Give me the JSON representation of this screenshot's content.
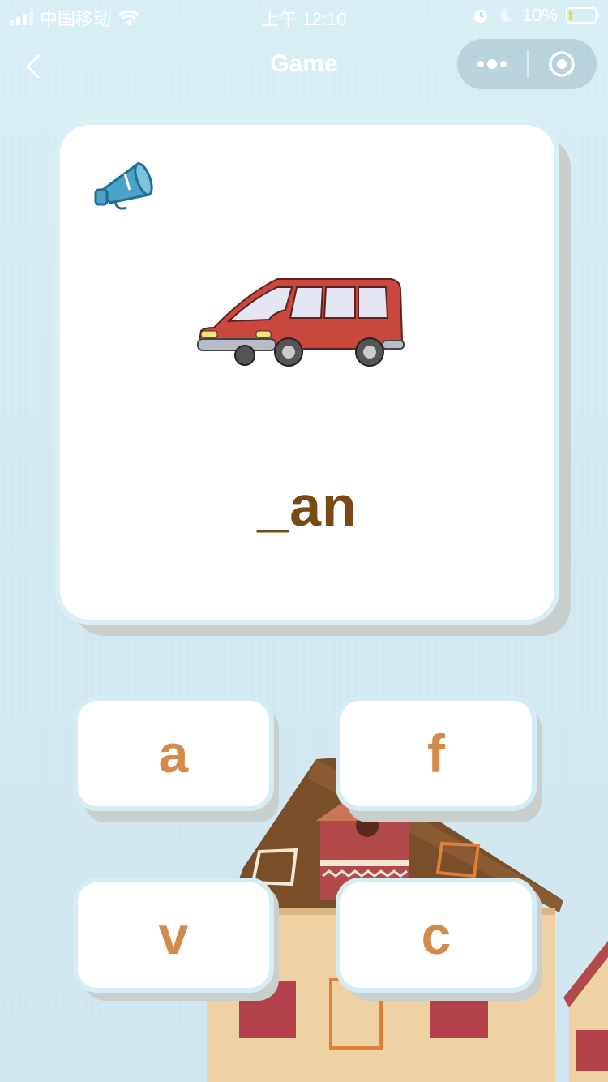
{
  "status_bar": {
    "carrier": "中国移动",
    "time": "上午 12:10",
    "battery": "10%"
  },
  "nav": {
    "title": "Game"
  },
  "card": {
    "word": "_an",
    "image_icon": "van-icon",
    "sound_icon": "megaphone-icon"
  },
  "options": [
    "a",
    "f",
    "v",
    "c"
  ],
  "colors": {
    "background": "#d6ecf3",
    "word_text": "#7a4a14",
    "option_text": "#d48a4a"
  }
}
